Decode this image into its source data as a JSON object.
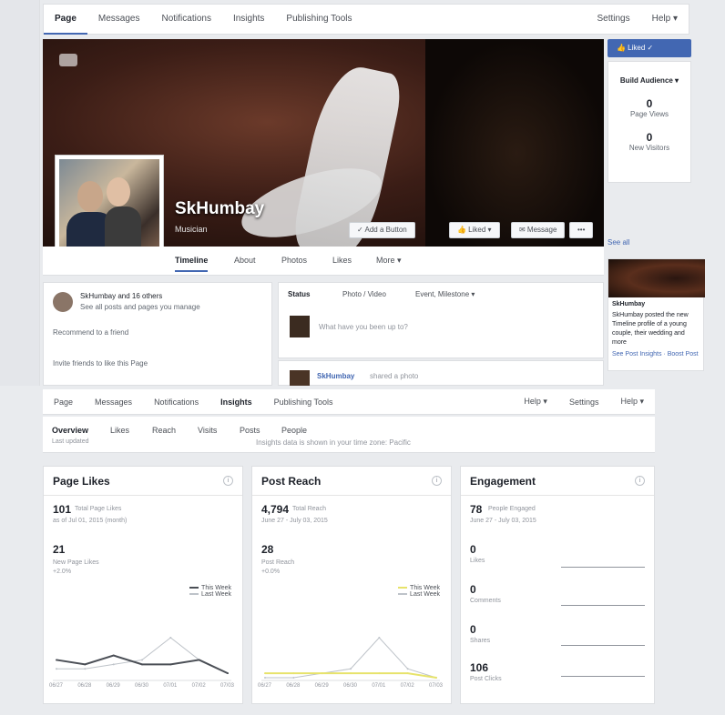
{
  "page": {
    "tabs": [
      "Page",
      "Messages",
      "Notifications",
      "Insights",
      "Publishing Tools"
    ],
    "right_links": [
      "Settings",
      "Help ▾"
    ],
    "cover": {
      "page_name": "SkHumbay",
      "category": "Musician"
    },
    "cover_buttons": [
      "✓ Add a Button",
      "👍 Liked ▾",
      "✉ Message",
      "•••"
    ],
    "subnav": [
      "Timeline",
      "About",
      "Photos",
      "Likes",
      "More ▾"
    ],
    "left": {
      "owner_line": "SkHumbay and 16 others",
      "owner_sub": "See all posts and pages you manage",
      "item1": "Recommend to a friend",
      "item2": "Invite friends to like this Page"
    },
    "composer": {
      "tabs": [
        "Status",
        "Photo / Video",
        "Event, Milestone ▾"
      ],
      "placeholder": "What have you been up to?"
    },
    "post": {
      "author": "SkHumbay",
      "meta": "shared a photo"
    },
    "right": {
      "like_button": "👍 Liked ✓",
      "build_audience": "Build Audience ▾",
      "stats": [
        {
          "value": "0",
          "label": "Page Views"
        },
        {
          "value": "0",
          "label": "New Visitors"
        }
      ],
      "see_all": "See all",
      "ad_title": "SkHumbay",
      "ad_text": "SkHumbay posted the new Timeline profile of a young couple, their wedding and more",
      "ad_link": "See Post Insights · Boost Post"
    }
  },
  "insights": {
    "tabs": [
      "Page",
      "Messages",
      "Notifications",
      "Insights",
      "Publishing Tools"
    ],
    "right_links": [
      "Help ▾",
      "Settings",
      "Help ▾"
    ],
    "subtabs": [
      "Overview",
      "Likes",
      "Reach",
      "Visits",
      "Posts",
      "People"
    ],
    "updated": "Last updated",
    "note": "Insights data is shown in your time zone: Pacific",
    "cards": [
      {
        "title": "Page Likes",
        "big": "101",
        "big_label": "Total Page Likes",
        "big_sub": "as of Jul 01, 2015 (month)",
        "second": "21",
        "second_label": "New Page Likes",
        "second_sub": "+2.0%",
        "legend": [
          "This Week",
          "Last Week"
        ]
      },
      {
        "title": "Post Reach",
        "big": "4,794",
        "big_label": "Total Reach",
        "big_sub": "June 27 - July 03, 2015",
        "second": "28",
        "second_label": "Post Reach",
        "second_sub": "+0.0%",
        "legend": [
          "This Week",
          "Last Week"
        ]
      },
      {
        "title": "Engagement",
        "big": "78",
        "big_label": "People Engaged",
        "big_sub": "June 27 - July 03, 2015",
        "rows": [
          {
            "value": "0",
            "label": "Likes"
          },
          {
            "value": "0",
            "label": "Comments"
          },
          {
            "value": "0",
            "label": "Shares"
          },
          {
            "value": "106",
            "label": "Post Clicks"
          }
        ]
      }
    ],
    "x_ticks": [
      "06/27",
      "06/28",
      "06/29",
      "06/30",
      "07/01",
      "07/02",
      "07/03"
    ]
  },
  "chart_data": [
    {
      "type": "line",
      "title": "Page Likes",
      "categories": [
        "06/27",
        "06/28",
        "06/29",
        "06/30",
        "07/01",
        "07/02",
        "07/03"
      ],
      "series": [
        {
          "name": "This Week",
          "values": [
            4,
            3,
            5,
            3,
            3,
            4,
            1
          ]
        },
        {
          "name": "Last Week",
          "values": [
            2,
            2,
            3,
            4,
            9,
            4,
            1
          ]
        }
      ]
    },
    {
      "type": "line",
      "title": "Post Reach",
      "categories": [
        "06/27",
        "06/28",
        "06/29",
        "06/30",
        "07/01",
        "07/02",
        "07/03"
      ],
      "series": [
        {
          "name": "This Week",
          "values": [
            1,
            1,
            1,
            1,
            1,
            1,
            0
          ]
        },
        {
          "name": "Last Week",
          "values": [
            0,
            0,
            1,
            2,
            9,
            2,
            0
          ]
        }
      ]
    }
  ]
}
